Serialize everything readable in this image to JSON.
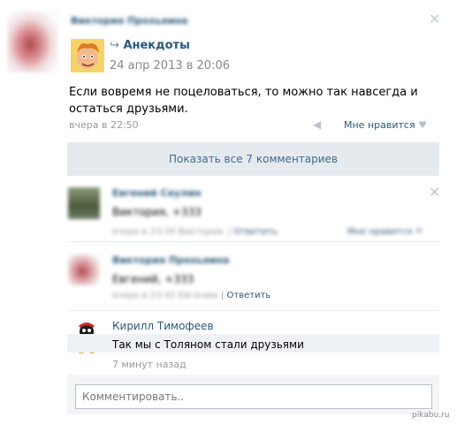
{
  "post": {
    "author": "Виктория Прохьяина",
    "repost_icon": "repost-arrow-icon",
    "group_name": "Анекдоты",
    "group_date": "24 апр 2013 в 20:06",
    "text_line1": "Если вовремя не поцеловаться, то можно так навсегда и",
    "text_line2": "остаться друзьями.",
    "time": "вчера в 22:50",
    "like_label": "Мне нравится"
  },
  "show_all_comments": "Показать все 7 комментариев",
  "comments": [
    {
      "author": "Евгений Сеулин",
      "text": "Виктория, +333",
      "meta": "вчера в 23:39 Виктории",
      "reply": "Ответить",
      "like": "Мне нравится"
    },
    {
      "author": "Виктория Прохьяина",
      "text": "Евгений, +333",
      "meta": "вчера в 23:42 Евгению",
      "reply": "Ответить"
    },
    {
      "author": "Кирилл Тимофеев",
      "text": "Так мы с Толяном стали друзьями",
      "meta": "7 минут назад"
    }
  ],
  "comment_placeholder": "Комментировать..",
  "watermark": "pikabu.ru",
  "colors": {
    "link": "#2b587a",
    "meta": "#999999",
    "button_bg": "#e5eaef",
    "button_text": "#45688e"
  }
}
